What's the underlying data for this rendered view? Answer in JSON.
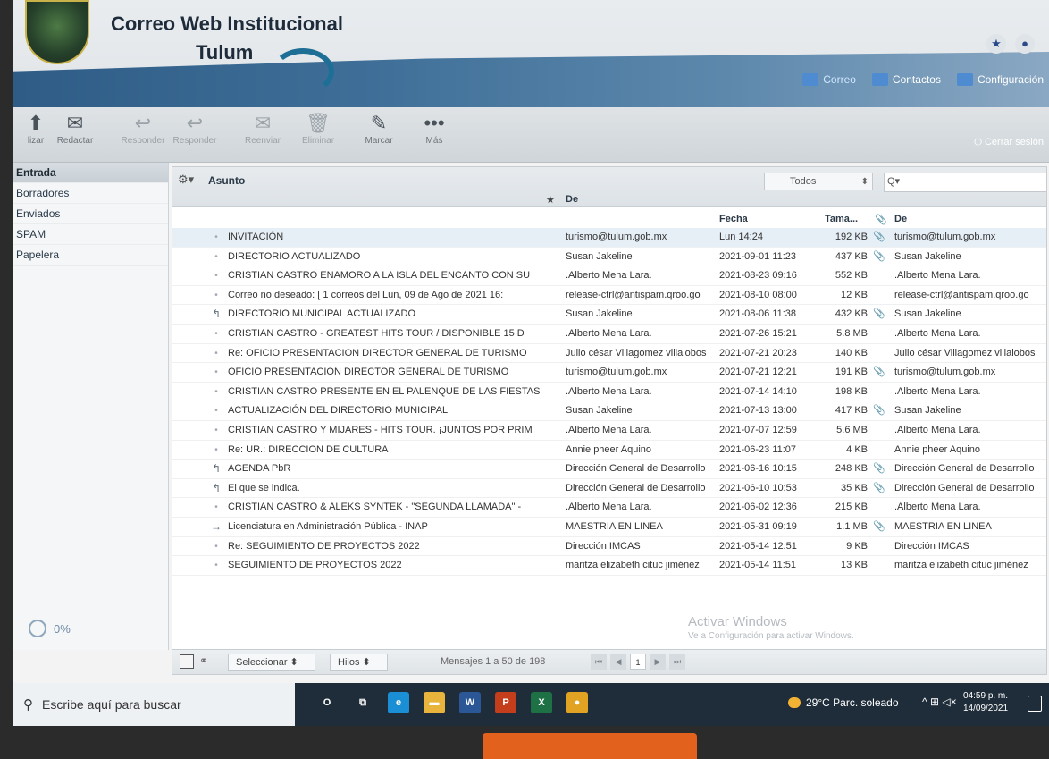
{
  "header": {
    "title": "Correo Web Institucional",
    "subtitle": "Tulum",
    "nav": [
      {
        "label": "Correo",
        "icon": "mail-icon"
      },
      {
        "label": "Contactos",
        "icon": "contacts-icon"
      },
      {
        "label": "Configuración",
        "icon": "gear-icon"
      }
    ],
    "logout_label": "Cerrar sesión",
    "logout_icon": "⏻"
  },
  "toolbar": {
    "buttons": [
      {
        "label": "lizar",
        "glyph": "⬆",
        "dim": false
      },
      {
        "label": "Redactar",
        "glyph": "✉",
        "dim": false
      },
      {
        "label": "Responder",
        "glyph": "↩",
        "dim": true
      },
      {
        "label": "Responder",
        "glyph": "↩",
        "dim": true
      },
      {
        "label": "Reenviar",
        "glyph": "✉",
        "dim": true
      },
      {
        "label": "Eliminar",
        "glyph": "🗑",
        "dim": true
      },
      {
        "label": "Marcar",
        "glyph": "✎",
        "dim": false
      },
      {
        "label": "Más",
        "glyph": "•••",
        "dim": false
      }
    ]
  },
  "sidebar": {
    "folders": [
      {
        "label": "Entrada",
        "active": true
      },
      {
        "label": "Borradores",
        "active": false
      },
      {
        "label": "Enviados",
        "active": false
      },
      {
        "label": "SPAM",
        "active": false
      },
      {
        "label": "Papelera",
        "active": false
      }
    ],
    "quota": "0%"
  },
  "list": {
    "col_subject": "Asunto",
    "filter": "Todos",
    "search_prefix": "Q▾",
    "col_from": "De",
    "col_date": "Fecha",
    "col_size": "Tama...",
    "col_from2": "De",
    "rows": [
      {
        "flag": "•",
        "subject": "INVITACIÓN",
        "from": "turismo@tulum.gob.mx",
        "date": "Lun 14:24",
        "size": "192 KB",
        "attach": true,
        "from2": "turismo@tulum.gob.mx"
      },
      {
        "flag": "•",
        "subject": "DIRECTORIO ACTUALIZADO",
        "from": "Susan Jakeline",
        "date": "2021-09-01 11:23",
        "size": "437 KB",
        "attach": true,
        "from2": "Susan Jakeline"
      },
      {
        "flag": "•",
        "subject": "CRISTIAN CASTRO ENAMORO A LA ISLA DEL ENCANTO CON SU",
        "from": ".Alberto Mena Lara.",
        "date": "2021-08-23 09:16",
        "size": "552 KB",
        "attach": false,
        "from2": ".Alberto Mena Lara."
      },
      {
        "flag": "•",
        "subject": "Correo no deseado: [ 1 correos del Lun, 09 de Ago de 2021 16:",
        "from": "release-ctrl@antispam.qroo.go",
        "date": "2021-08-10 08:00",
        "size": "12 KB",
        "attach": false,
        "from2": "release-ctrl@antispam.qroo.go"
      },
      {
        "flag": "↰",
        "subject": "DIRECTORIO MUNICIPAL ACTUALIZADO",
        "from": "Susan Jakeline",
        "date": "2021-08-06 11:38",
        "size": "432 KB",
        "attach": true,
        "from2": "Susan Jakeline"
      },
      {
        "flag": "•",
        "subject": "CRISTIAN CASTRO - GREATEST HITS TOUR / DISPONIBLE 15 D",
        "from": ".Alberto Mena Lara.",
        "date": "2021-07-26 15:21",
        "size": "5.8 MB",
        "attach": false,
        "from2": ".Alberto Mena Lara."
      },
      {
        "flag": "•",
        "subject": "Re: OFICIO PRESENTACION DIRECTOR GENERAL DE TURISMO",
        "from": "Julio césar Villagomez villalobos",
        "date": "2021-07-21 20:23",
        "size": "140 KB",
        "attach": false,
        "from2": "Julio césar Villagomez villalobos"
      },
      {
        "flag": "•",
        "subject": "OFICIO PRESENTACION DIRECTOR GENERAL DE TURISMO",
        "from": "turismo@tulum.gob.mx",
        "date": "2021-07-21 12:21",
        "size": "191 KB",
        "attach": true,
        "from2": "turismo@tulum.gob.mx"
      },
      {
        "flag": "•",
        "subject": "CRISTIAN CASTRO PRESENTE EN EL PALENQUE DE LAS FIESTAS",
        "from": ".Alberto Mena Lara.",
        "date": "2021-07-14 14:10",
        "size": "198 KB",
        "attach": false,
        "from2": ".Alberto Mena Lara."
      },
      {
        "flag": "•",
        "subject": "ACTUALIZACIÓN DEL DIRECTORIO MUNICIPAL",
        "from": "Susan Jakeline",
        "date": "2021-07-13 13:00",
        "size": "417 KB",
        "attach": true,
        "from2": "Susan Jakeline"
      },
      {
        "flag": "•",
        "subject": "CRISTIAN CASTRO Y MIJARES - HITS TOUR. ¡JUNTOS POR PRIM",
        "from": ".Alberto Mena Lara.",
        "date": "2021-07-07 12:59",
        "size": "5.6 MB",
        "attach": false,
        "from2": ".Alberto Mena Lara."
      },
      {
        "flag": "•",
        "subject": "Re: UR.: DIRECCION DE CULTURA",
        "from": "Annie pheer Aquino",
        "date": "2021-06-23 11:07",
        "size": "4 KB",
        "attach": false,
        "from2": "Annie pheer Aquino"
      },
      {
        "flag": "↰",
        "subject": "AGENDA PbR",
        "from": "Dirección General de Desarrollo",
        "date": "2021-06-16 10:15",
        "size": "248 KB",
        "attach": true,
        "from2": "Dirección General de Desarrollo"
      },
      {
        "flag": "↰",
        "subject": "El que se indica.",
        "from": "Dirección General de Desarrollo",
        "date": "2021-06-10 10:53",
        "size": "35 KB",
        "attach": true,
        "from2": "Dirección General de Desarrollo"
      },
      {
        "flag": "•",
        "subject": "CRISTIAN CASTRO & ALEKS SYNTEK - \"SEGUNDA LLAMADA\" -",
        "from": ".Alberto Mena Lara.",
        "date": "2021-06-02 12:36",
        "size": "215 KB",
        "attach": false,
        "from2": ".Alberto Mena Lara."
      },
      {
        "flag": "→",
        "subject": "Licenciatura en Administración Pública - INAP",
        "from": "MAESTRIA EN LINEA",
        "date": "2021-05-31 09:19",
        "size": "1.1 MB",
        "attach": true,
        "from2": "MAESTRIA EN LINEA"
      },
      {
        "flag": "•",
        "subject": "Re: SEGUIMIENTO DE PROYECTOS 2022",
        "from": "Dirección IMCAS",
        "date": "2021-05-14 12:51",
        "size": "9 KB",
        "attach": false,
        "from2": "Dirección IMCAS"
      },
      {
        "flag": "•",
        "subject": "SEGUIMIENTO DE PROYECTOS 2022",
        "from": "maritza elizabeth cituc jiménez",
        "date": "2021-05-14 11:51",
        "size": "13 KB",
        "attach": false,
        "from2": "maritza elizabeth cituc jiménez"
      }
    ]
  },
  "footer": {
    "select_label": "Seleccionar",
    "threads_label": "Hilos",
    "count": "Mensajes 1 a 50 de 198",
    "page": "1"
  },
  "watermark": {
    "line1": "Activar Windows",
    "line2": "Ve a Configuración para activar Windows."
  },
  "taskbar": {
    "search_placeholder": "Escribe aquí para buscar",
    "weather": "29°C  Parc. soleado",
    "time": "04:59 p. m.",
    "date": "14/09/2021",
    "apps": [
      {
        "name": "cortana",
        "glyph": "O",
        "color": "#1f2d3a"
      },
      {
        "name": "task-view",
        "glyph": "⧉",
        "color": "#1f2d3a"
      },
      {
        "name": "edge",
        "glyph": "e",
        "color": "#1a8fd6"
      },
      {
        "name": "file-explorer",
        "glyph": "▬",
        "color": "#e8b43b"
      },
      {
        "name": "word",
        "glyph": "W",
        "color": "#2b5797"
      },
      {
        "name": "powerpoint",
        "glyph": "P",
        "color": "#c43e1c"
      },
      {
        "name": "excel",
        "glyph": "X",
        "color": "#1e7145"
      },
      {
        "name": "chrome",
        "glyph": "●",
        "color": "#e1a321"
      }
    ]
  }
}
